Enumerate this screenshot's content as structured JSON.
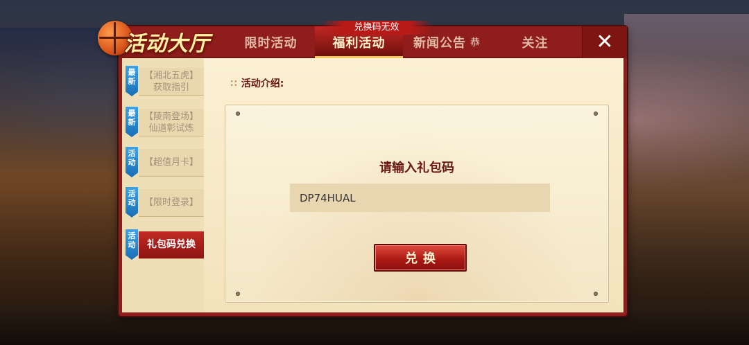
{
  "header": {
    "title": "活动大厅",
    "tabs": [
      {
        "label": "限时活动",
        "active": false
      },
      {
        "label": "福利活动",
        "active": true
      },
      {
        "label": "新闻公告",
        "extra": "恭",
        "active": false
      },
      {
        "label": "关注",
        "active": false
      }
    ],
    "close_icon": "close-icon"
  },
  "toast": "兑换码无效",
  "sidebar": {
    "items": [
      {
        "badge": "最新",
        "line1": "【湘北五虎】",
        "line2": "获取指引",
        "active": false
      },
      {
        "badge": "最新",
        "line1": "【陵南登场】",
        "line2": "仙道彰试炼",
        "active": false
      },
      {
        "badge": "活动",
        "line1": "【超值月卡】",
        "line2": "",
        "active": false
      },
      {
        "badge": "活动",
        "line1": "【限时登录】",
        "line2": "",
        "active": false
      },
      {
        "badge": "活动",
        "line1": "礼包码兑换",
        "line2": "",
        "active": true
      }
    ]
  },
  "main": {
    "intro_label": "活动介绍:",
    "card_title": "请输入礼包码",
    "code_value": "DP74HUAL",
    "redeem_label": "兑换"
  },
  "colors": {
    "panel_red": "#8f1d1b",
    "accent_gold": "#f0c860",
    "badge_blue": "#1a6fb5"
  }
}
